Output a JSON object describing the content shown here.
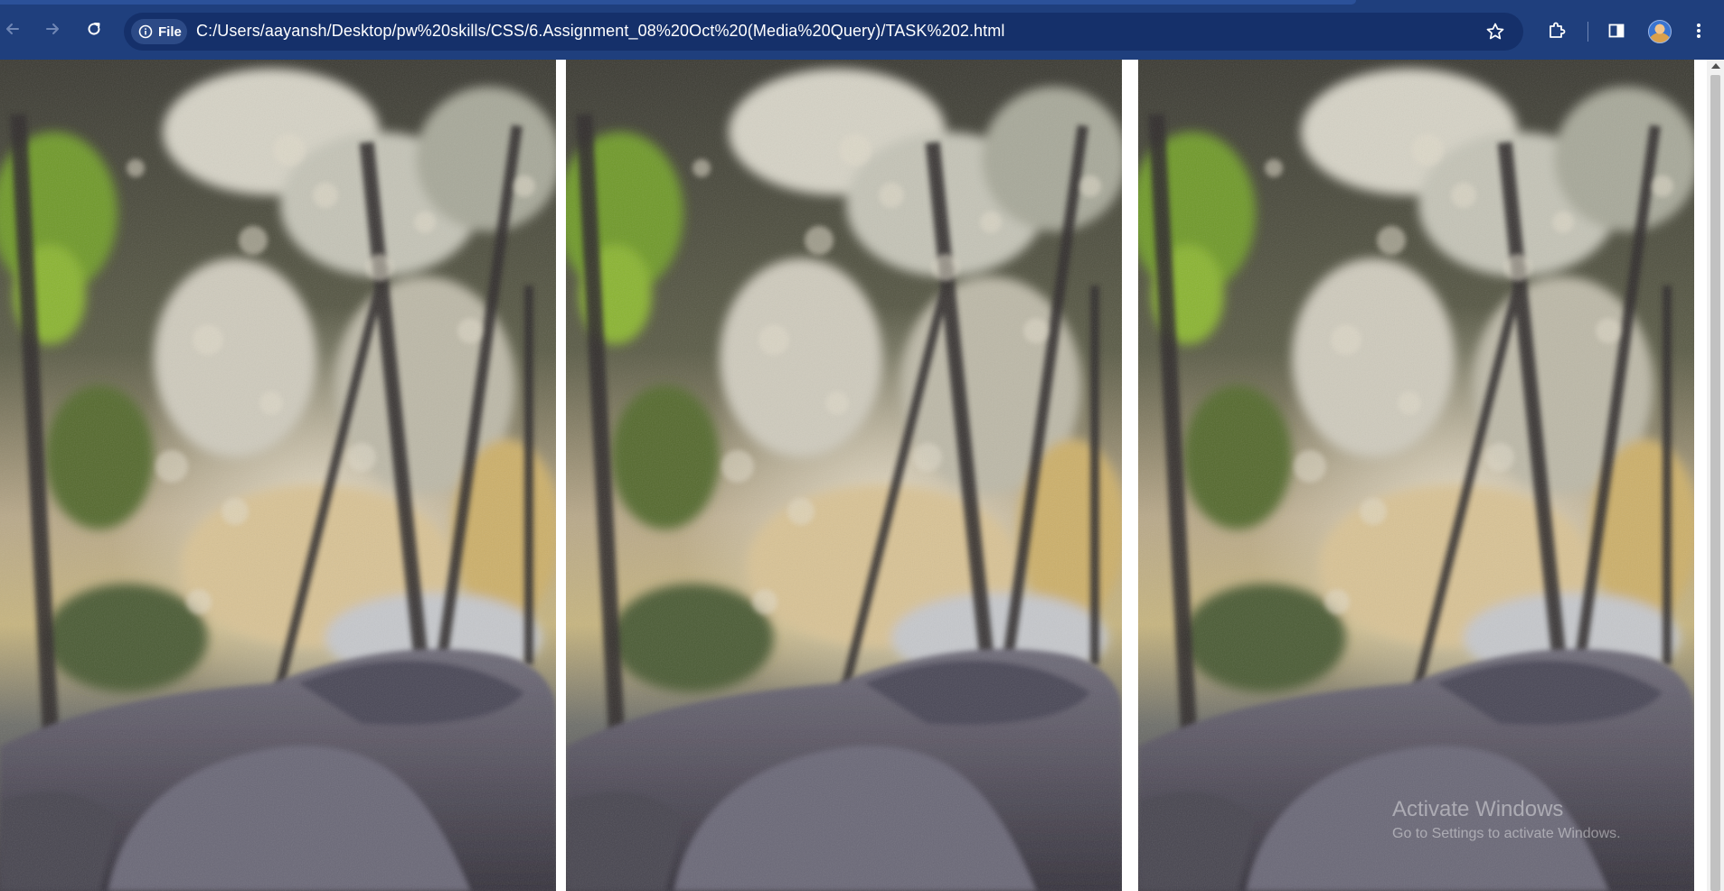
{
  "browser": {
    "origin_chip": "File",
    "url": "C:/Users/aayansh/Desktop/pw%20skills/CSS/6.Assignment_08%20Oct%20(Media%20Query)/TASK%202.html"
  },
  "page": {
    "images": [
      {
        "alt": "blurred forest with rocks",
        "name": "image-1"
      },
      {
        "alt": "blurred forest with rocks",
        "name": "image-2"
      },
      {
        "alt": "blurred forest with rocks",
        "name": "image-3"
      }
    ]
  },
  "watermark": {
    "title": "Activate Windows",
    "subtitle": "Go to Settings to activate Windows."
  },
  "icons": {
    "back": "back-arrow-icon",
    "forward": "forward-arrow-icon",
    "reload": "reload-icon",
    "info": "info-icon",
    "bookmark": "star-icon",
    "extensions": "puzzle-icon",
    "side_panel": "side-panel-icon",
    "menu": "kebab-menu-icon"
  },
  "colors": {
    "toolbar": "#1f3f7d",
    "omnibox": "#15306a"
  }
}
